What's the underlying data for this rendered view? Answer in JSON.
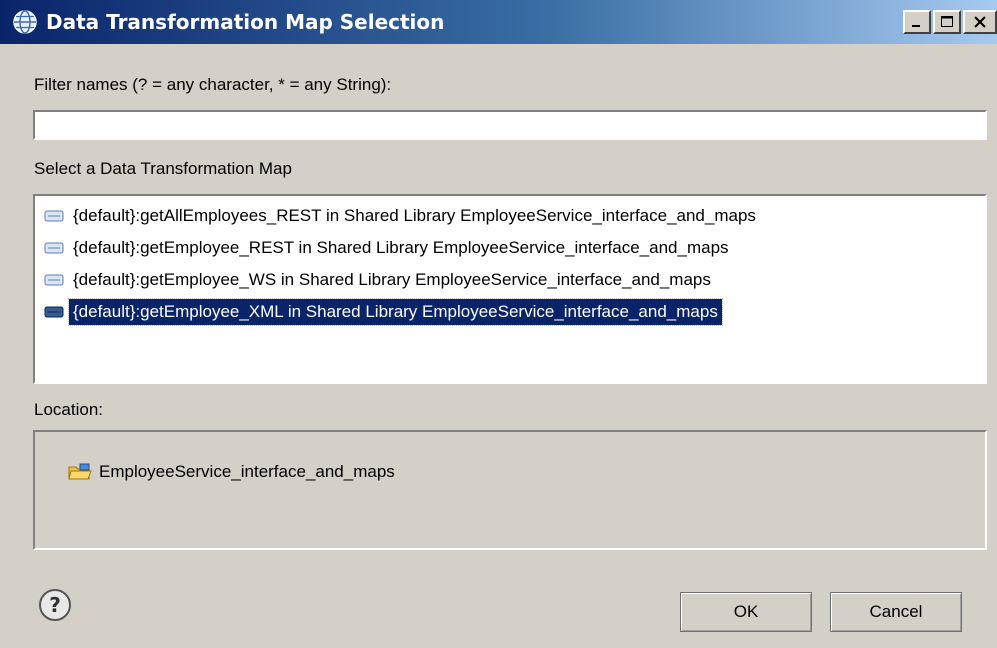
{
  "window": {
    "title": "Data Transformation Map Selection",
    "controls": {
      "minimize": "_",
      "maximize": "□",
      "close": "X"
    }
  },
  "filter": {
    "label": "Filter names (? = any character, * = any String):",
    "value": "",
    "placeholder": ""
  },
  "map_list": {
    "label": "Select a Data Transformation Map",
    "items": [
      {
        "label": "{default}:getAllEmployees_REST in Shared Library EmployeeService_interface_and_maps",
        "selected": false
      },
      {
        "label": "{default}:getEmployee_REST in Shared Library EmployeeService_interface_and_maps",
        "selected": false
      },
      {
        "label": "{default}:getEmployee_WS in Shared Library EmployeeService_interface_and_maps",
        "selected": false
      },
      {
        "label": "{default}:getEmployee_XML in Shared Library EmployeeService_interface_and_maps",
        "selected": true
      }
    ]
  },
  "location": {
    "label": "Location:",
    "item": "EmployeeService_interface_and_maps",
    "icon": "library-folder-icon"
  },
  "buttons": {
    "ok": "OK",
    "cancel": "Cancel",
    "help_icon": "help-icon"
  },
  "colors": {
    "selection": "#0a246a",
    "dialog_bg": "#d4d0c8",
    "title_gradient_start": "#0a246a"
  }
}
